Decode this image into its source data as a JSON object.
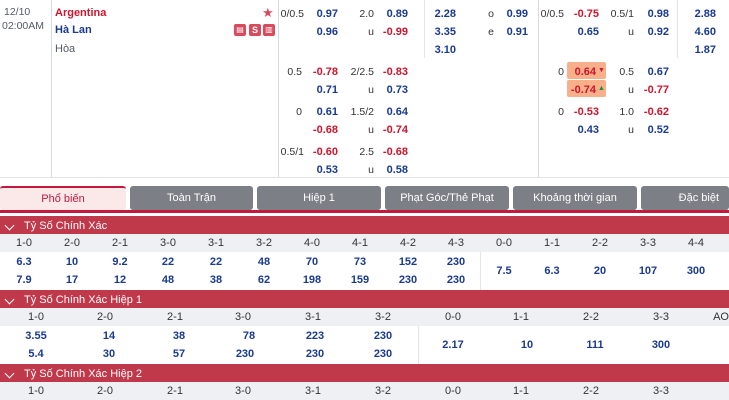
{
  "match": {
    "date": "12/10",
    "time": "02:00AM",
    "home": "Argentina",
    "away": "Hà Lan",
    "draw": "Hòa",
    "badge_icons": [
      "tv-icon",
      "s-icon",
      "stats-icon"
    ]
  },
  "odds": {
    "fh_hdp": [
      {
        "line": "0/0.5",
        "home": "0.97",
        "away": "0.96"
      },
      {
        "line": "0.5",
        "home": "-0.78",
        "away": "0.71"
      },
      {
        "line": "0",
        "home": "0.61",
        "away": "-0.68"
      },
      {
        "line": "0.5/1",
        "home": "-0.60",
        "away": "0.53"
      }
    ],
    "fh_ou": [
      {
        "line": "2.0",
        "over": "0.89",
        "u": "u",
        "under": "-0.99"
      },
      {
        "line": "2/2.5",
        "over": "-0.83",
        "u": "u",
        "under": "0.73"
      },
      {
        "line": "1.5/2",
        "over": "0.64",
        "u": "u",
        "under": "-0.74"
      },
      {
        "line": "2.5",
        "over": "-0.68",
        "u": "u",
        "under": "0.58"
      }
    ],
    "fh_1x2": [
      "2.28",
      "3.35",
      "3.10"
    ],
    "oe": {
      "o": "o",
      "o_val": "0.99",
      "e": "e",
      "e_val": "0.91"
    },
    "h1_hdp": [
      {
        "line": "0/0.5",
        "home": "-0.75",
        "away": "0.65"
      },
      {
        "line": "0",
        "home": "0.64",
        "away": "-0.74"
      },
      {
        "line": "0",
        "home": "-0.53",
        "away": "0.43"
      }
    ],
    "h1_ou": [
      {
        "line": "0.5/1",
        "over": "0.98",
        "u": "u",
        "under": "0.92"
      },
      {
        "line": "0.5",
        "over": "0.67",
        "u": "u",
        "under": "-0.77"
      },
      {
        "line": "1.0",
        "over": "-0.62",
        "u": "u",
        "under": "0.52"
      }
    ],
    "h1_1x2": [
      "2.88",
      "4.60",
      "1.87"
    ]
  },
  "tabs": [
    "Phổ biến",
    "Toàn Trận",
    "Hiệp 1",
    "Phạt Góc/Thẻ Phạt",
    "Khoảng thời gian",
    "Đặc biệt"
  ],
  "sections": [
    {
      "title": "Tỷ Số Chính Xác",
      "scores": [
        "1-0",
        "2-0",
        "2-1",
        "3-0",
        "3-1",
        "3-2",
        "4-0",
        "4-1",
        "4-2",
        "4-3",
        "0-0",
        "1-1",
        "2-2",
        "3-3",
        "4-4"
      ],
      "row1": [
        "6.3",
        "10",
        "9.2",
        "22",
        "22",
        "48",
        "70",
        "73",
        "152",
        "230"
      ],
      "row2": [
        "7.9",
        "17",
        "12",
        "48",
        "38",
        "62",
        "198",
        "159",
        "230",
        "230"
      ],
      "draws": [
        "7.5",
        "6.3",
        "20",
        "107",
        "300"
      ]
    },
    {
      "title": "Tỷ Số Chính Xác Hiệp 1",
      "scores": [
        "1-0",
        "2-0",
        "2-1",
        "3-0",
        "3-1",
        "3-2",
        "0-0",
        "1-1",
        "2-2",
        "3-3",
        "AO"
      ],
      "row1": [
        "3.55",
        "14",
        "38",
        "78",
        "223",
        "230"
      ],
      "row2": [
        "5.4",
        "30",
        "57",
        "230",
        "230",
        "230"
      ],
      "draws": [
        "2.17",
        "10",
        "111",
        "300"
      ]
    },
    {
      "title": "Tỷ Số Chính Xác Hiệp 2",
      "scores": [
        "1-0",
        "2-0",
        "2-1",
        "3-0",
        "3-1",
        "3-2",
        "0-0",
        "1-1",
        "2-2",
        "3-3"
      ]
    }
  ]
}
